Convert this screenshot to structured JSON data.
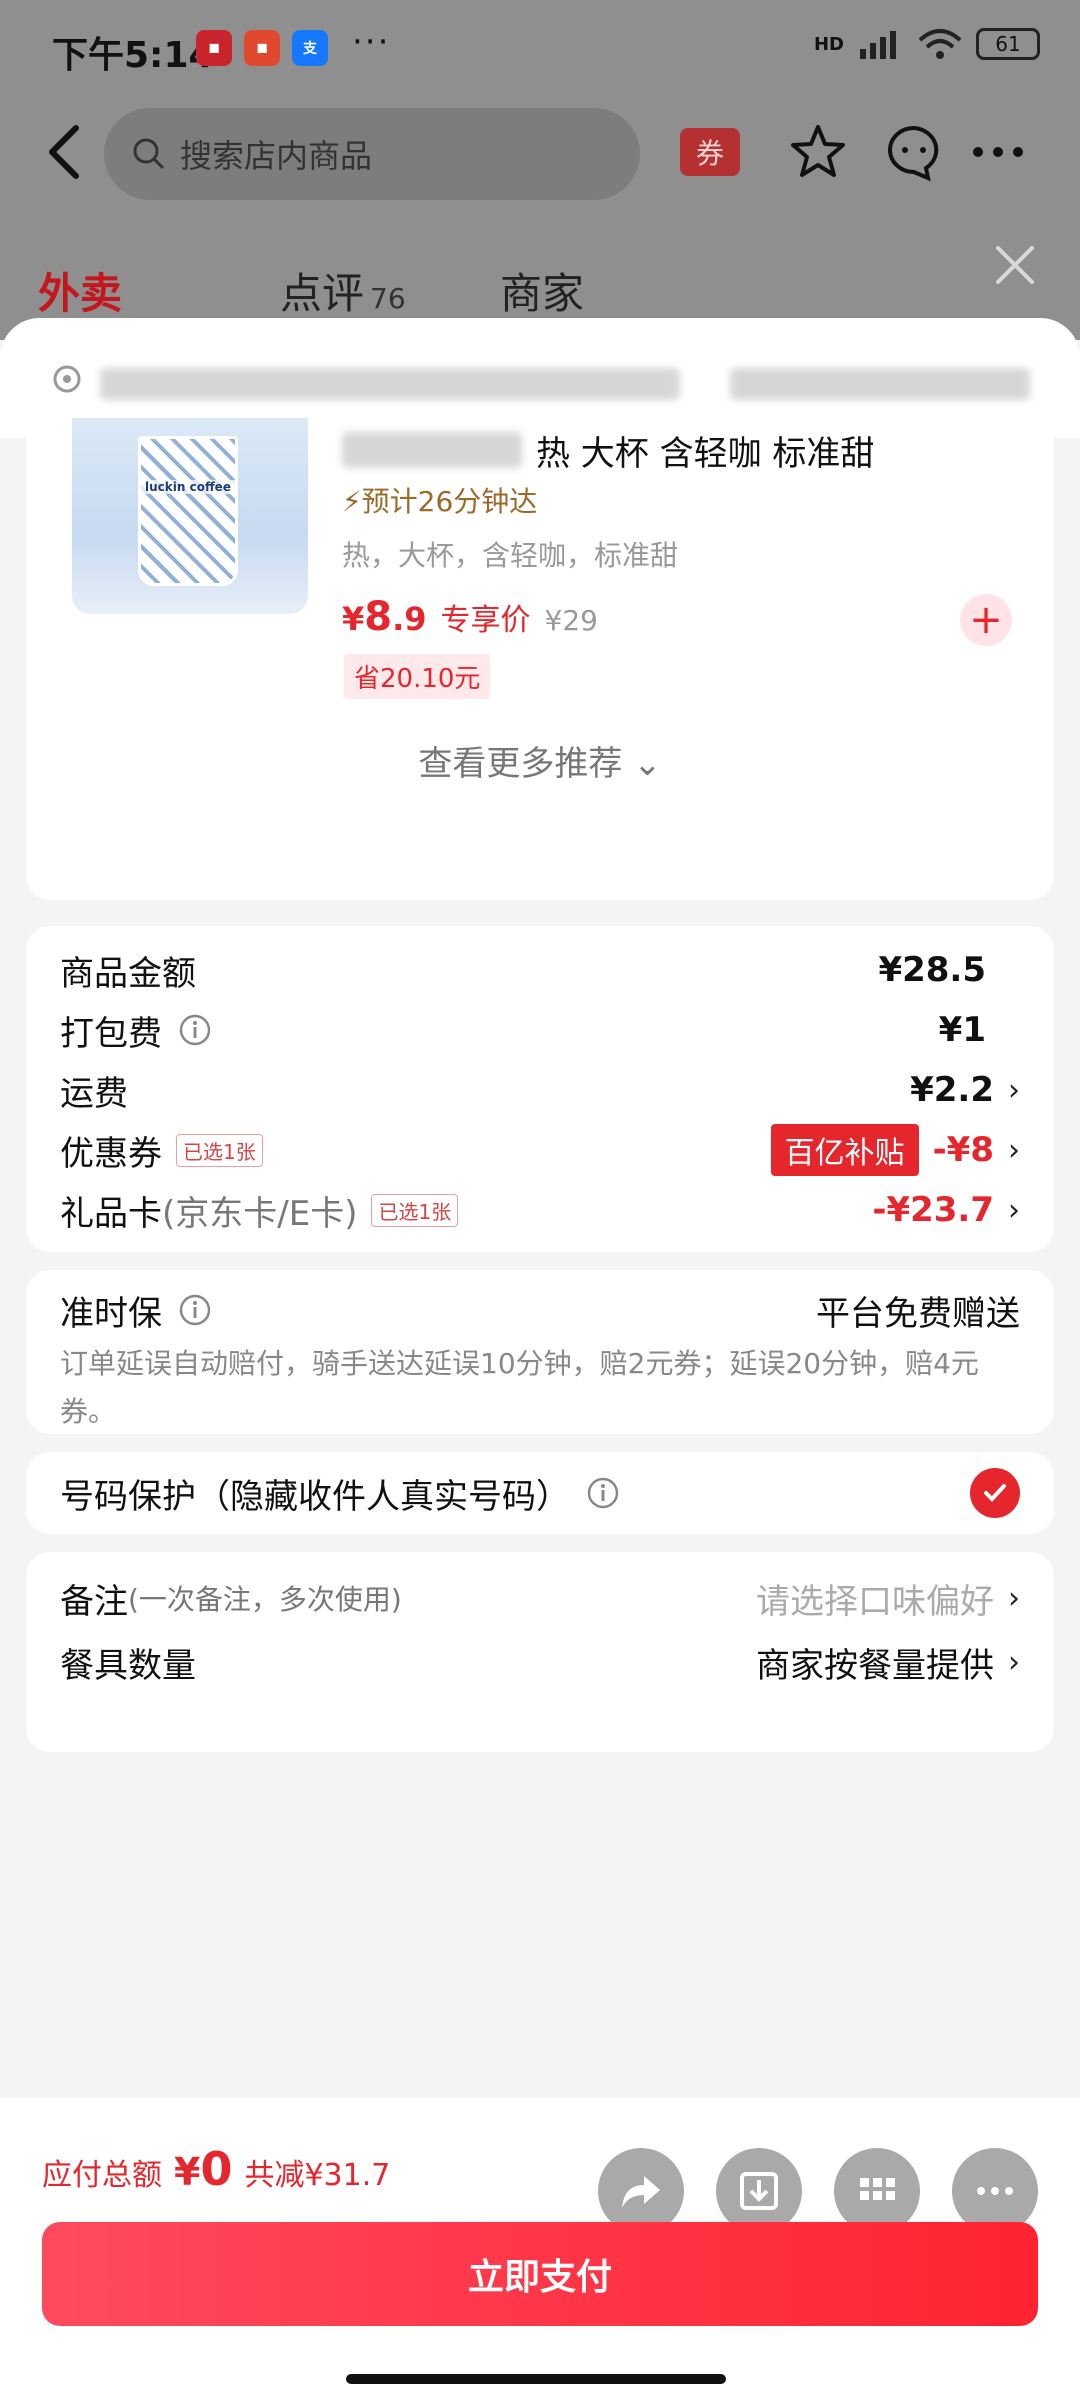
{
  "status": {
    "time": "下午5:14",
    "battery": "61",
    "network": "HD"
  },
  "nav": {
    "search_placeholder": "搜索店内商品",
    "coupon_label": "券"
  },
  "bg_tabs": {
    "takeout": "外卖",
    "reviews": "点评",
    "reviews_count": "76",
    "merchant": "商家"
  },
  "product": {
    "name": "热 大杯 含轻咖 标准甜",
    "eta": "预计26分钟达",
    "spec": "热，大杯，含轻咖，标准甜",
    "price_symbol": "¥",
    "price_int": "8",
    "price_dec": ".9",
    "price_tag": "专享价",
    "old_price": "¥29",
    "save": "省20.10元",
    "cup_brand": "luckin coffee"
  },
  "more_recommend": "查看更多推荐",
  "fees": {
    "goods_label": "商品金额",
    "goods_value": "¥28.5",
    "packing_label": "打包费",
    "packing_value": "¥1",
    "shipping_label": "运费",
    "shipping_value": "¥2.2",
    "coupon_label": "优惠券",
    "coupon_badge": "已选1张",
    "coupon_tag": "百亿补贴",
    "coupon_value": "-¥8",
    "gift_label": "礼品卡",
    "gift_sub": "(京东卡/E卡)",
    "gift_badge": "已选1张",
    "gift_value": "-¥23.7"
  },
  "ontime": {
    "label": "准时保",
    "value": "平台免费赠送",
    "desc": "订单延误自动赔付，骑手送达延误10分钟，赔2元券；延误20分钟，赔4元券。"
  },
  "privacy": {
    "label": "号码保护（隐藏收件人真实号码）"
  },
  "remarks": {
    "label": "备注",
    "sub": "(一次备注，多次使用)",
    "placeholder": "请选择口味偏好",
    "utensils_label": "餐具数量",
    "utensils_value": "商家按餐量提供"
  },
  "bottom": {
    "total_label": "应付总额",
    "total_symbol": "¥",
    "total_value": "0",
    "discount": "共减¥31.7",
    "pay_button": "立即支付"
  },
  "colors": {
    "accent": "#e5262c",
    "gold": "#9a6a28"
  }
}
